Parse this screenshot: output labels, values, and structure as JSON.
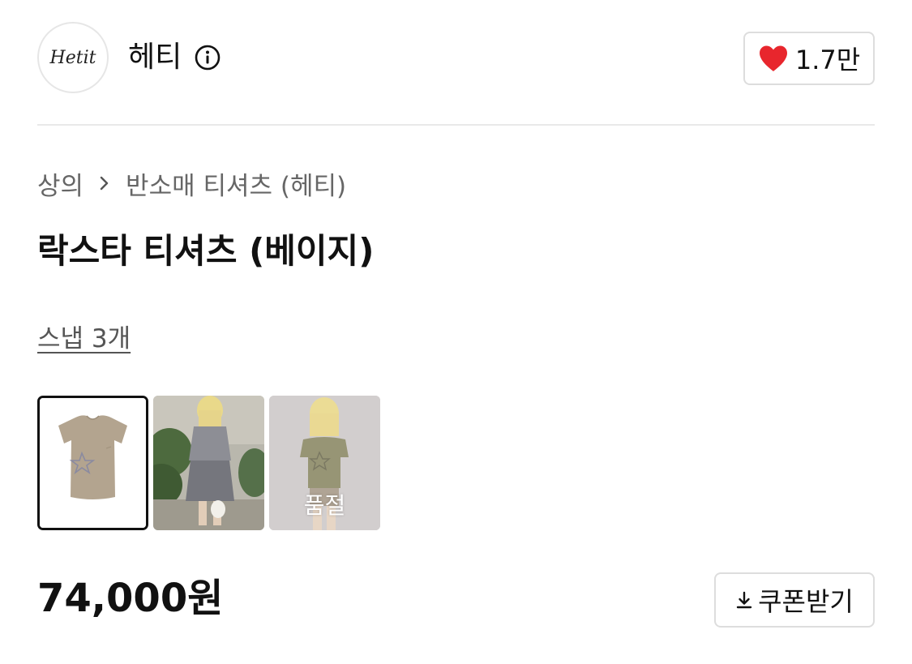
{
  "brand": {
    "logo_text": "Hetit",
    "name": "헤티",
    "info_icon": "info-circle-icon",
    "like": {
      "icon": "heart-icon",
      "icon_color": "#e8262d",
      "count": "1.7만"
    }
  },
  "breadcrumb": {
    "items": [
      {
        "label": "상의"
      },
      {
        "label": "반소매 티셔츠 (헤티)"
      }
    ],
    "separator_icon": "chevron-right-icon"
  },
  "product": {
    "title": "락스타 티셔츠 (베이지)",
    "snap_link": "스냅 3개",
    "thumbnails": [
      {
        "selected": true,
        "soldout_label": ""
      },
      {
        "selected": false,
        "soldout_label": ""
      },
      {
        "selected": false,
        "soldout_label": "품절"
      }
    ],
    "price": "74,000원",
    "coupon": {
      "icon": "download-icon",
      "label": "쿠폰받기"
    }
  }
}
